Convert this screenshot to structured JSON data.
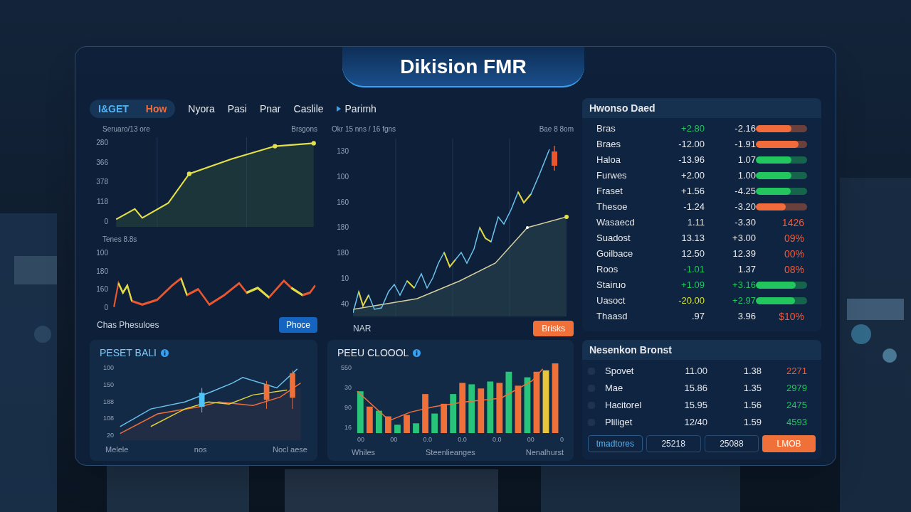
{
  "title": "Dikision FMR",
  "tabs": [
    {
      "label": "I&GET",
      "selected": true,
      "caret": false,
      "color": "#4fb3f6"
    },
    {
      "label": "How",
      "selected": true,
      "caret": false,
      "color": "#f26b3a"
    },
    {
      "label": "Nyora",
      "selected": false,
      "caret": false,
      "color": "#e5e7eb"
    },
    {
      "label": "Pasi",
      "selected": false,
      "caret": false,
      "color": "#e5e7eb"
    },
    {
      "label": "Pnar",
      "selected": false,
      "caret": false,
      "color": "#e5e7eb"
    },
    {
      "label": "Caslile",
      "selected": false,
      "caret": false,
      "color": "#e5e7eb"
    },
    {
      "label": "Parimh",
      "selected": false,
      "caret": true,
      "color": "#e5e7eb"
    }
  ],
  "chart_left_top": {
    "caption": "Seruaro/13 ore",
    "legend": "Brsgons",
    "y_labels": [
      "280",
      "366",
      "378",
      "118",
      "0"
    ]
  },
  "chart_left_bottom": {
    "caption": "Tenes 8.8s",
    "y_labels": [
      "100",
      "180",
      "160",
      "0"
    ],
    "footer": "Chas Phesuloes",
    "button": "Phoce"
  },
  "chart_main": {
    "caption": "Okr 15 nns / 16 fgns",
    "legend": "Bae 8 8om",
    "y_labels": [
      "130",
      "100",
      "160",
      "180",
      "180",
      "10",
      "40"
    ],
    "footer": "NAR",
    "button": "Brisks"
  },
  "watchlist": {
    "title": "Hwonso Daed",
    "rows": [
      {
        "name": "Bras",
        "change": {
          "text": "+2.80",
          "color": "#22c55e"
        },
        "value": {
          "text": "-2.16",
          "color": "#e5e7eb"
        },
        "kind": "bar",
        "level": 0.7,
        "color": "#f26b3a"
      },
      {
        "name": "Braes",
        "change": {
          "text": "-12.00",
          "color": "#e5e7eb"
        },
        "value": {
          "text": "-1.91",
          "color": "#e5e7eb"
        },
        "kind": "bar",
        "level": 0.83,
        "color": "#f26b3a"
      },
      {
        "name": "Haloa",
        "change": {
          "text": "-13.96",
          "color": "#e5e7eb"
        },
        "value": {
          "text": "1.07",
          "color": "#e5e7eb"
        },
        "kind": "bar",
        "level": 0.7,
        "color": "#22c55e"
      },
      {
        "name": "Furwes",
        "change": {
          "text": "+2.00",
          "color": "#e5e7eb"
        },
        "value": {
          "text": "1.00",
          "color": "#e5e7eb"
        },
        "kind": "bar",
        "level": 0.69,
        "color": "#22c55e"
      },
      {
        "name": "Fraset",
        "change": {
          "text": "+1.56",
          "color": "#e5e7eb"
        },
        "value": {
          "text": "-4.25",
          "color": "#e5e7eb"
        },
        "kind": "bar",
        "level": 0.68,
        "color": "#22c55e"
      },
      {
        "name": "Thesoe",
        "change": {
          "text": "-1.24",
          "color": "#e5e7eb"
        },
        "value": {
          "text": "-3.20",
          "color": "#e5e7eb"
        },
        "kind": "bar",
        "level": 0.58,
        "color": "#f26b3a"
      },
      {
        "name": "Wasaecd",
        "change": {
          "text": "1.11",
          "color": "#e5e7eb"
        },
        "value": {
          "text": "-3.30",
          "color": "#e5e7eb"
        },
        "kind": "text",
        "reading": "1426",
        "color": "#f05a3a"
      },
      {
        "name": "Suadost",
        "change": {
          "text": "13.13",
          "color": "#e5e7eb"
        },
        "value": {
          "text": "+3.00",
          "color": "#e5e7eb"
        },
        "kind": "text",
        "reading": "09%",
        "color": "#f05a3a"
      },
      {
        "name": "Goilbace",
        "change": {
          "text": "12.50",
          "color": "#e5e7eb"
        },
        "value": {
          "text": "12.39",
          "color": "#e5e7eb"
        },
        "kind": "text",
        "reading": "00%",
        "color": "#f05a3a"
      },
      {
        "name": "Roos",
        "change": {
          "text": "-1.01",
          "color": "#22c55e"
        },
        "value": {
          "text": "1.37",
          "color": "#e5e7eb"
        },
        "kind": "text",
        "reading": "08%",
        "color": "#f05a3a"
      },
      {
        "name": "Stairuo",
        "change": {
          "text": "+1.09",
          "color": "#22c55e"
        },
        "value": {
          "text": "+3.16",
          "color": "#22c55e"
        },
        "kind": "bar",
        "level": 0.78,
        "color": "#22c55e"
      },
      {
        "name": "Uasoct",
        "change": {
          "text": "-20.00",
          "color": "#d4e034"
        },
        "value": {
          "text": "+2.97",
          "color": "#22c55e"
        },
        "kind": "bar",
        "level": 0.77,
        "color": "#22c55e"
      },
      {
        "name": "Thaasd",
        "change": {
          "text": ".97",
          "color": "#e5e7eb"
        },
        "value": {
          "text": "3.96",
          "color": "#e5e7eb"
        },
        "kind": "text",
        "reading": "$10%",
        "color": "#f05a3a"
      }
    ]
  },
  "card_left": {
    "title": "PESET BALI",
    "y_labels": [
      "100",
      "150",
      "188",
      "108",
      "20"
    ],
    "x_labels": [
      "Melele",
      "nos",
      "Nocl aese"
    ]
  },
  "card_mid": {
    "title": "PEEU CLOOOL",
    "y_labels": [
      "550",
      "30",
      "90",
      "16"
    ],
    "x_ticks": [
      "00",
      "00",
      "0.0",
      "0.0",
      "0.0",
      "00",
      "0"
    ],
    "x_labels": [
      "Whiles",
      "Steenlieanges",
      "Nenalhurst"
    ]
  },
  "accounts": {
    "title": "Nesenkon Bronst",
    "rows": [
      {
        "name": "Spovet",
        "col_2": "11.00",
        "col_3": "1.38",
        "col_4": {
          "text": "2271",
          "color": "#f05a3a"
        }
      },
      {
        "name": "Mae",
        "col_2": "15.86",
        "col_3": "1.35",
        "col_4": {
          "text": "2979",
          "color": "#22c55e"
        }
      },
      {
        "name": "Hacitorel",
        "col_2": "15.95",
        "col_3": "1.56",
        "col_4": {
          "text": "2475",
          "color": "#22c55e"
        }
      },
      {
        "name": "Pliliget",
        "col_2": "12/40",
        "col_3": "1.59",
        "col_4": {
          "text": "4593",
          "color": "#22c55e"
        }
      }
    ],
    "buttons": [
      {
        "label": "tmadtores",
        "kind": "accent"
      },
      {
        "label": "25218",
        "kind": "outline"
      },
      {
        "label": "25088",
        "kind": "outline"
      },
      {
        "label": "LMOB",
        "kind": "primary"
      }
    ]
  }
}
